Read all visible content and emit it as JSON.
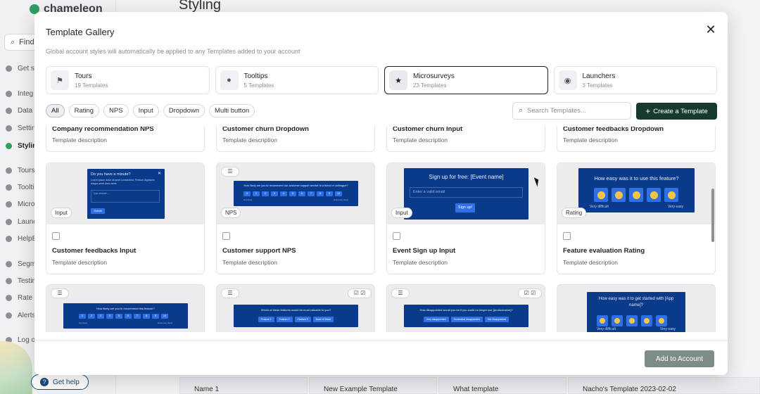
{
  "bg": {
    "brand": "chameleon",
    "find": "Find",
    "page_title": "Styling",
    "nav": [
      "Get s",
      "Integ",
      "Data",
      "Settin",
      "Stylin",
      "Tours",
      "Toolti",
      "Micro",
      "Launc",
      "HelpB",
      "Segm",
      "Testin",
      "Rate",
      "Alerts",
      "Log o"
    ],
    "get_help": "Get help",
    "rows": [
      "Name 1",
      "New Example Template",
      "What template",
      "Nacho's Template 2023-02-02"
    ]
  },
  "modal": {
    "title": "Template Gallery",
    "subtitle": "Global account styles will automatically be applied to any Templates added to your account",
    "categories": [
      {
        "name": "Tours",
        "count": "19 Templates",
        "icon": "signpost-icon"
      },
      {
        "name": "Tooltips",
        "count": "5 Templates",
        "icon": "speech-bubble-icon"
      },
      {
        "name": "Microsurveys",
        "count": "23 Templates",
        "icon": "star-icon"
      },
      {
        "name": "Launchers",
        "count": "3 Templates",
        "icon": "lightbulb-icon"
      }
    ],
    "filters": [
      "All",
      "Rating",
      "NPS",
      "Input",
      "Dropdown",
      "Multi button"
    ],
    "search_placeholder": "Search Templates...",
    "create_label": "Create a Template",
    "add_label": "Add to Account"
  },
  "cards_top": [
    {
      "name": "Company recommendation NPS",
      "desc": "Template description"
    },
    {
      "name": "Customer churn Dropdown",
      "desc": "Template description"
    },
    {
      "name": "Customer churn Input",
      "desc": "Template description"
    },
    {
      "name": "Customer feedbacks Dropdown",
      "desc": "Template description"
    }
  ],
  "cards_mid": [
    {
      "name": "Customer feedbacks Input",
      "desc": "Template description",
      "badge": "Input",
      "q": "Do you have a minute?",
      "body": "Lorem ipsum dolor sit amet consectetur. Pretium dignissim eisque amet diam amet.",
      "placeholder": "Type answer...",
      "btn": "Submit"
    },
    {
      "name": "Customer support NPS",
      "desc": "Template description",
      "badge": "NPS",
      "q": "How likely are you to recommend our customer support service to a friend or colleague?",
      "scale": [
        "0",
        "1",
        "2",
        "3",
        "4",
        "5",
        "6",
        "7",
        "8",
        "9",
        "10"
      ],
      "low": "Not likely",
      "high": "Extremely likely"
    },
    {
      "name": "Event Sign up Input",
      "desc": "Template description",
      "badge": "Input",
      "q": "Sign up for free: [Event name]",
      "placeholder": "Enter a valid email",
      "btn": "Sign up!"
    },
    {
      "name": "Feature evaluation Rating",
      "desc": "Template description",
      "badge": "Rating",
      "q": "How easy was it to use this feature?",
      "low": "Very difficult",
      "high": "Very easy"
    }
  ],
  "cards_bot": [
    {
      "q": "How likely are you to recommend this feature?",
      "scale": [
        "1",
        "2",
        "3",
        "4",
        "5",
        "6",
        "7",
        "8",
        "9",
        "10"
      ],
      "low": "Not likely",
      "high": "Extremely likely"
    },
    {
      "q": "Which of these features would be most valuable to you?",
      "options": [
        "Feature 1",
        "Feature 2",
        "Feature 3",
        "None of these"
      ]
    },
    {
      "q": "How disappointed would you be if you could no longer use [productname]?",
      "options": [
        "Very disappointed",
        "Somewhat disappointed",
        "Not disappointed"
      ]
    },
    {
      "q": "How easy was it to get started with [App name]?",
      "low": "Very difficult",
      "high": "Very easy"
    }
  ]
}
